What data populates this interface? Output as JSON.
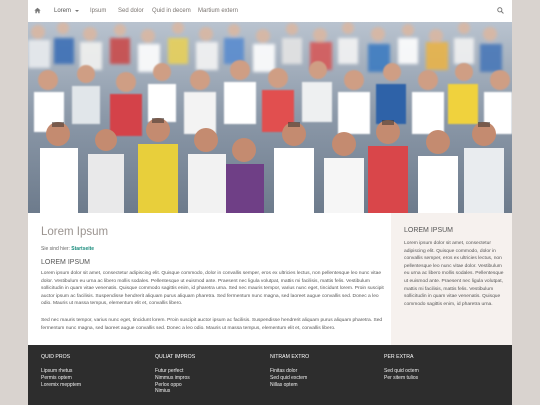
{
  "nav": {
    "items": [
      {
        "label": "Lorem",
        "has_dropdown": true
      },
      {
        "label": "Ipsum"
      },
      {
        "label": "Sed dolor"
      },
      {
        "label": "Quid in decem"
      },
      {
        "label": "Martium extern"
      }
    ]
  },
  "hero": {
    "icon": "photo-runners-crowd"
  },
  "main": {
    "title": "Lorem Ipsum",
    "breadcrumb_prefix": "Sie sind hier:",
    "breadcrumb_link": "Startseite",
    "heading": "LOREM IPSUM",
    "paragraph_1": "Lorem ipsum dolor sit amet, consectetur adipiscing elit. Quisque commodo, dolor in convallis semper, eros ex ultricies lectus, non pellentesque leo nunc vitae dolor. Vestibulum eu urna ac libero mollis sodales. Pellentesque ut euismod ante. Praesent nec ligula volutpat, mattis mi facilisis, mattis felis. Vestibulum sollicitudin in quam vitae venenatis. Quisque commodo sagittis enim, id pharetra urna. Sed nec mauris tempor, varius nunc eget, tincidunt lorem. Proin suscipit auctor ipsum ac facilisis. Suspendisse hendrerit aliquam purus aliquam pharetra. Sed fermentum nunc magna, sed laoreet augue convallis sed. Donec a leo odio. Mauris ut massa tempus, elementum elit et, convallis libero.",
    "paragraph_2": "Sed nec mauris tempor, varius nunc eget, tincidunt lorem. Proin suscipit auctor ipsum ac facilisis. Suspendisse hendrerit aliquam purus aliquam pharetra. Sed fermentum nunc magna, sed laoreet augue convallis sed. Donec a leo odio. Mauris ut massa tempus, elementum elit et, convallis libero."
  },
  "sidebar": {
    "heading": "LOREM IPSUM",
    "text": "Lorem ipsum dolor sit amet, consectetur adipiscing elit. Quisque commodo, dolor in convallis semper, eros ex ultricies lectus, non pellentesque leo nunc vitae dolor. Vestibulum eu urna ac libero mollis sodales. Pellentesque ut euismod ante. Praesent nec ligula volutpat, mattis mi facilisis, mattis felis. Vestibulum sollicitudin in quam vitae venenatis. Quisque commodo sagittis enim, id pharetra urna."
  },
  "footer": {
    "columns": [
      {
        "heading": "QUID PROS",
        "links": [
          "Lipsum rhetus",
          "Permis optem",
          "Loremix mepptem"
        ]
      },
      {
        "heading": "QULIAT IMPROS",
        "links": [
          "Futur perfect",
          "Nimmus impros",
          "Perlox oppo",
          "Nimius"
        ]
      },
      {
        "heading": "NITRAM EXTRO",
        "links": [
          "Finitas dolor",
          "Sed quid exctem",
          "Nillas optem"
        ]
      },
      {
        "heading": "PER EXTRA",
        "links": [
          "Sed quid octem",
          "Per sitem tulios"
        ]
      }
    ]
  },
  "colors": {
    "accent": "#1a8c7d",
    "footer_bg": "#2d2d2d",
    "sidebar_bg": "#f6f1ee",
    "frame_bg": "#d9d3cf"
  }
}
